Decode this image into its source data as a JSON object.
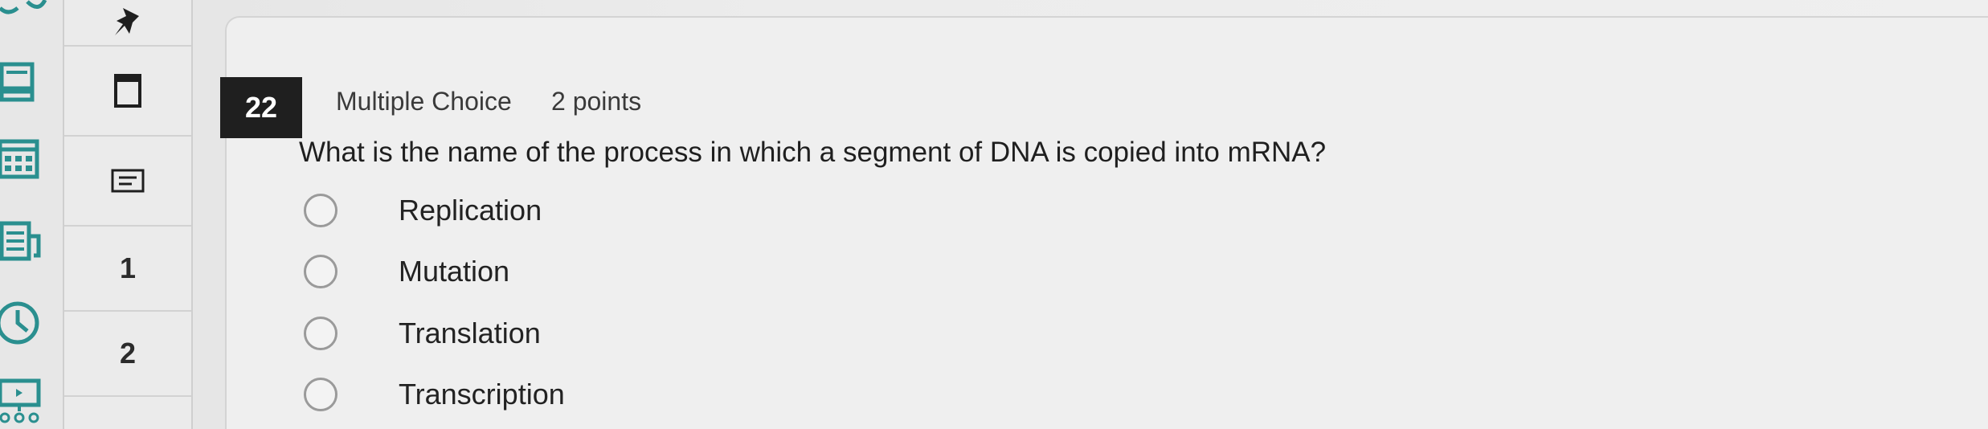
{
  "global_nav": {
    "icons": [
      "account-icon",
      "dashboard-icon",
      "calendar-icon",
      "inbox-icon",
      "history-icon",
      "studio-icon"
    ],
    "accent_color": "#2a8f8f"
  },
  "question_nav": {
    "icons": [
      "pin-icon",
      "flag-icon",
      "notes-icon"
    ],
    "items": [
      "1",
      "2"
    ]
  },
  "question": {
    "number": "22",
    "type": "Multiple Choice",
    "points": "2 points",
    "text": "What is the name of the process in which a segment of DNA is copied into mRNA?",
    "options": [
      "Replication",
      "Mutation",
      "Translation",
      "Transcription"
    ]
  }
}
